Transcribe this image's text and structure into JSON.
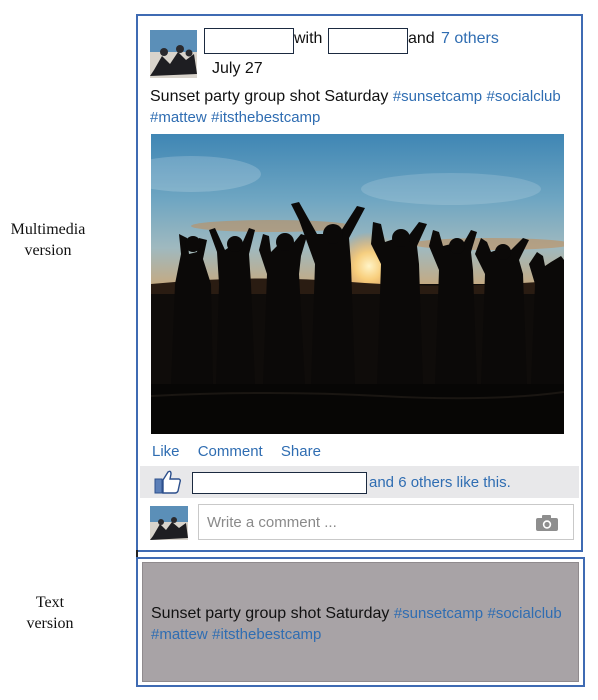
{
  "labels": {
    "multimedia": [
      "Multimedia",
      "version"
    ],
    "text": [
      "Text",
      "version"
    ]
  },
  "post": {
    "with_word": "with",
    "and_word": "and",
    "others_link": "7 others",
    "date": "July 27",
    "caption_text": "Sunset party group shot Saturday",
    "hashtags": [
      "#sunsetcamp",
      "#socialclub",
      "#mattew",
      "#itsthebestcamp"
    ],
    "photo_icon": "group-silhouette-sunset-photo"
  },
  "actions": [
    "Like",
    "Comment",
    "Share"
  ],
  "likes": {
    "icon": "thumbs-up-icon",
    "text": "and 6 others like this."
  },
  "comment": {
    "placeholder": "Write a comment ...",
    "icon": "camera-icon"
  },
  "text_version": {
    "caption_text": "Sunset party group shot Saturday",
    "hashtags": [
      "#sunsetcamp",
      "#socialclub",
      "#mattew",
      "#itsthebestcamp"
    ]
  },
  "colors": {
    "border": "#3f6bb3",
    "link": "#2f6db2",
    "like_bar": "#e8e8ea",
    "text_panel": "#a8a3a6"
  }
}
